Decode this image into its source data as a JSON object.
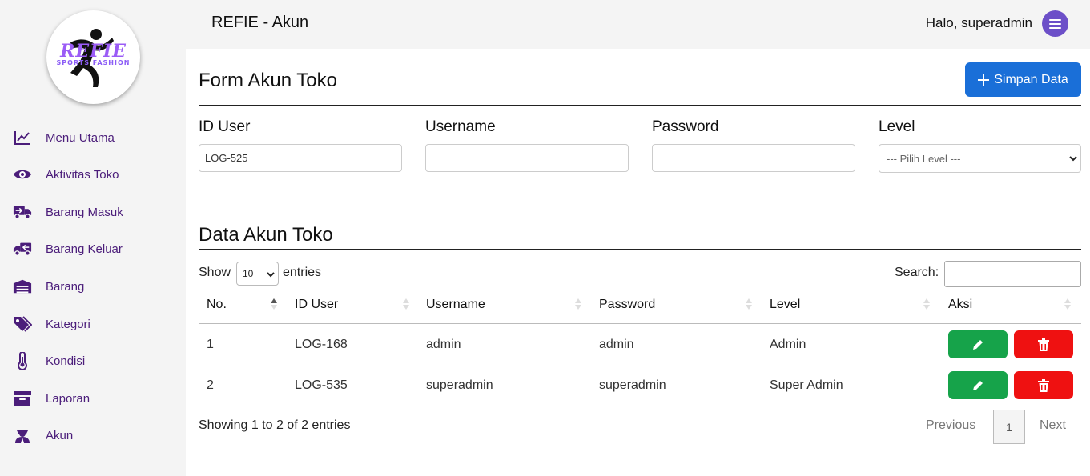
{
  "logo": {
    "main": "REFIE",
    "sub": "SPORTS FASHION"
  },
  "sidebar": {
    "items": [
      {
        "label": "Menu Utama",
        "icon": "chart-line-icon"
      },
      {
        "label": "Aktivitas Toko",
        "icon": "eye-icon"
      },
      {
        "label": "Barang Masuk",
        "icon": "truck-icon"
      },
      {
        "label": "Barang Keluar",
        "icon": "truck-return-icon"
      },
      {
        "label": "Barang",
        "icon": "warehouse-icon"
      },
      {
        "label": "Kategori",
        "icon": "tags-icon"
      },
      {
        "label": "Kondisi",
        "icon": "thermometer-icon"
      },
      {
        "label": "Laporan",
        "icon": "archive-icon"
      },
      {
        "label": "Akun",
        "icon": "user-tie-icon"
      }
    ]
  },
  "header": {
    "title": "REFIE - Akun",
    "greeting": "Halo, superadmin"
  },
  "form": {
    "title": "Form Akun Toko",
    "save_label": "Simpan Data",
    "fields": {
      "id_user": {
        "label": "ID User",
        "value": "LOG-525"
      },
      "username": {
        "label": "Username",
        "value": ""
      },
      "password": {
        "label": "Password",
        "value": ""
      },
      "level": {
        "label": "Level",
        "selected": "--- Pilih Level ---"
      }
    }
  },
  "table": {
    "title": "Data Akun Toko",
    "show_label": "Show",
    "length_value": "10",
    "entries_label": "entries",
    "search_label": "Search:",
    "columns": [
      "No.",
      "ID User",
      "Username",
      "Password",
      "Level",
      "Aksi"
    ],
    "rows": [
      {
        "no": "1",
        "id_user": "LOG-168",
        "username": "admin",
        "password": "admin",
        "level": "Admin"
      },
      {
        "no": "2",
        "id_user": "LOG-535",
        "username": "superadmin",
        "password": "superadmin",
        "level": "Super Admin"
      }
    ],
    "info": "Showing 1 to 2 of 2 entries",
    "pagination": {
      "previous": "Previous",
      "current": "1",
      "next": "Next"
    }
  },
  "colors": {
    "accent": "#4b1d7a",
    "primary": "#1a6fd8",
    "success": "#16a34a",
    "danger": "#ef1111",
    "menu": "#6c4fc8"
  }
}
